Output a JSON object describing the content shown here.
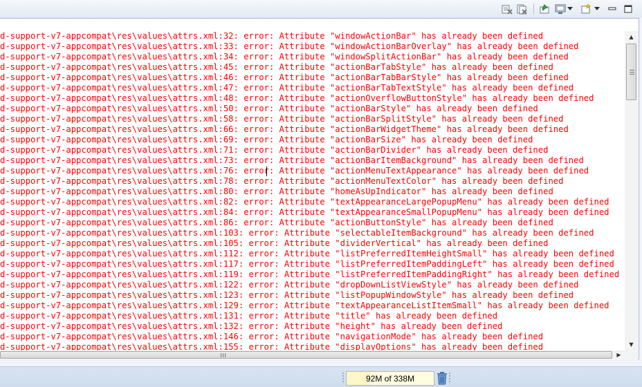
{
  "toolbar": {
    "icons": [
      "remove-launch-icon",
      "remove-all-terminated-icon",
      "pin-console-icon",
      "display-selected-console-icon",
      "open-console-icon",
      "minimize-icon",
      "maximize-icon"
    ]
  },
  "console": {
    "lines": [
      "d-support-v7-appcompat\\res\\values\\attrs.xml:32: error: Attribute \"windowActionBar\" has already been defined",
      "d-support-v7-appcompat\\res\\values\\attrs.xml:33: error: Attribute \"windowActionBarOverlay\" has already been defined",
      "d-support-v7-appcompat\\res\\values\\attrs.xml:34: error: Attribute \"windowSplitActionBar\" has already been defined",
      "d-support-v7-appcompat\\res\\values\\attrs.xml:45: error: Attribute \"actionBarTabStyle\" has already been defined",
      "d-support-v7-appcompat\\res\\values\\attrs.xml:46: error: Attribute \"actionBarTabBarStyle\" has already been defined",
      "d-support-v7-appcompat\\res\\values\\attrs.xml:47: error: Attribute \"actionBarTabTextStyle\" has already been defined",
      "d-support-v7-appcompat\\res\\values\\attrs.xml:48: error: Attribute \"actionOverflowButtonStyle\" has already been defined",
      "d-support-v7-appcompat\\res\\values\\attrs.xml:50: error: Attribute \"actionBarStyle\" has already been defined",
      "d-support-v7-appcompat\\res\\values\\attrs.xml:58: error: Attribute \"actionBarSplitStyle\" has already been defined",
      "d-support-v7-appcompat\\res\\values\\attrs.xml:66: error: Attribute \"actionBarWidgetTheme\" has already been defined",
      "d-support-v7-appcompat\\res\\values\\attrs.xml:69: error: Attribute \"actionBarSize\" has already been defined",
      "d-support-v7-appcompat\\res\\values\\attrs.xml:71: error: Attribute \"actionBarDivider\" has already been defined",
      "d-support-v7-appcompat\\res\\values\\attrs.xml:73: error: Attribute \"actionBarItemBackground\" has already been defined",
      "d-support-v7-appcompat\\res\\values\\attrs.xml:76: error: Attribute \"actionMenuTextAppearance\" has already been defined",
      "d-support-v7-appcompat\\res\\values\\attrs.xml:78: error: Attribute \"actionMenuTextColor\" has already been defined",
      "d-support-v7-appcompat\\res\\values\\attrs.xml:80: error: Attribute \"homeAsUpIndicator\" has already been defined",
      "d-support-v7-appcompat\\res\\values\\attrs.xml:82: error: Attribute \"textAppearanceLargePopupMenu\" has already been defined",
      "d-support-v7-appcompat\\res\\values\\attrs.xml:84: error: Attribute \"textAppearanceSmallPopupMenu\" has already been defined",
      "d-support-v7-appcompat\\res\\values\\attrs.xml:86: error: Attribute \"actionButtonStyle\" has already been defined",
      "d-support-v7-appcompat\\res\\values\\attrs.xml:103: error: Attribute \"selectableItemBackground\" has already been defined",
      "d-support-v7-appcompat\\res\\values\\attrs.xml:105: error: Attribute \"dividerVertical\" has already been defined",
      "d-support-v7-appcompat\\res\\values\\attrs.xml:112: error: Attribute \"listPreferredItemHeightSmall\" has already been defined",
      "d-support-v7-appcompat\\res\\values\\attrs.xml:117: error: Attribute \"listPreferredItemPaddingLeft\" has already been defined",
      "d-support-v7-appcompat\\res\\values\\attrs.xml:119: error: Attribute \"listPreferredItemPaddingRight\" has already been defined",
      "d-support-v7-appcompat\\res\\values\\attrs.xml:122: error: Attribute \"dropDownListViewStyle\" has already been defined",
      "d-support-v7-appcompat\\res\\values\\attrs.xml:123: error: Attribute \"listPopupWindowStyle\" has already been defined",
      "d-support-v7-appcompat\\res\\values\\attrs.xml:129: error: Attribute \"textAppearanceListItemSmall\" has already been defined",
      "d-support-v7-appcompat\\res\\values\\attrs.xml:131: error: Attribute \"title\" has already been defined",
      "d-support-v7-appcompat\\res\\values\\attrs.xml:132: error: Attribute \"height\" has already been defined",
      "d-support-v7-appcompat\\res\\values\\attrs.xml:146: error: Attribute \"navigationMode\" has already been defined",
      "d-support-v7-appcompat\\res\\values\\attrs.xml:155: error: Attribute \"displayOptions\" has already been defined"
    ],
    "text_color": "#ff0000"
  },
  "statusbar": {
    "heap_label": "92M of 338M",
    "heap_used_fraction": 0.272,
    "gc_icon": "trash-icon"
  }
}
